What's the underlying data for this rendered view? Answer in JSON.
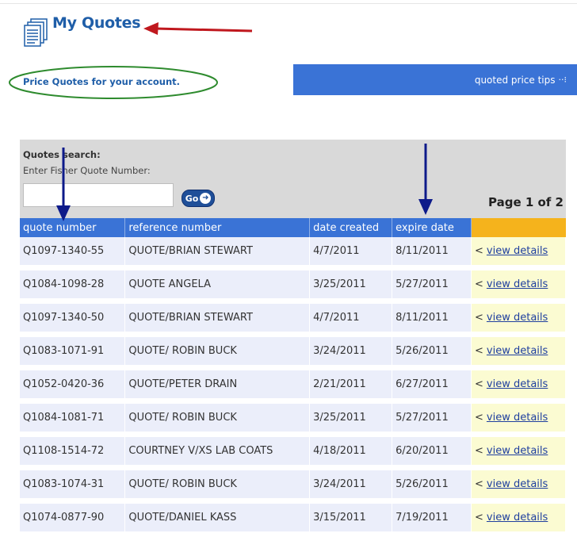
{
  "header": {
    "title": "My Quotes",
    "subtitle": "Price Quotes for your account.",
    "tips_label": "quoted price tips"
  },
  "search": {
    "title": "Quotes search:",
    "label": "Enter Fisher Quote Number:",
    "value": "",
    "go_label": "Go"
  },
  "pagination": "Page 1 of 2",
  "table": {
    "columns": [
      "quote number",
      "reference number",
      "date created",
      "expire date",
      ""
    ],
    "action_label": "view details",
    "rows": [
      {
        "quote": "Q1097-1340-55",
        "ref": "QUOTE/BRIAN STEWART",
        "created": "4/7/2011",
        "expire": "8/11/2011"
      },
      {
        "quote": "Q1084-1098-28",
        "ref": "QUOTE ANGELA",
        "created": "3/25/2011",
        "expire": "5/27/2011"
      },
      {
        "quote": "Q1097-1340-50",
        "ref": "QUOTE/BRIAN STEWART",
        "created": "4/7/2011",
        "expire": "8/11/2011"
      },
      {
        "quote": "Q1083-1071-91",
        "ref": "QUOTE/ ROBIN BUCK",
        "created": "3/24/2011",
        "expire": "5/26/2011"
      },
      {
        "quote": "Q1052-0420-36",
        "ref": "QUOTE/PETER DRAIN",
        "created": "2/21/2011",
        "expire": "6/27/2011"
      },
      {
        "quote": "Q1084-1081-71",
        "ref": "QUOTE/ ROBIN BUCK",
        "created": "3/25/2011",
        "expire": "5/27/2011"
      },
      {
        "quote": "Q1108-1514-72",
        "ref": "COURTNEY V/XS LAB COATS",
        "created": "4/18/2011",
        "expire": "6/20/2011"
      },
      {
        "quote": "Q1083-1074-31",
        "ref": "QUOTE/ ROBIN BUCK",
        "created": "3/24/2011",
        "expire": "5/26/2011"
      },
      {
        "quote": "Q1074-0877-90",
        "ref": "QUOTE/DANIEL KASS",
        "created": "3/15/2011",
        "expire": "7/19/2011"
      }
    ]
  },
  "colors": {
    "title_blue": "#1f5ea8",
    "header_blue": "#3a73d6",
    "action_orange": "#f5b31c",
    "annotation_red": "#c0181e",
    "annotation_green": "#2e8b2e",
    "annotation_navy": "#0d1a8a"
  },
  "icons": [
    "document-stack-icon",
    "dotted-arrow-icon",
    "go-arrow-icon",
    "red-arrow-annotation",
    "green-ellipse-annotation",
    "navy-arrow-annotation"
  ]
}
